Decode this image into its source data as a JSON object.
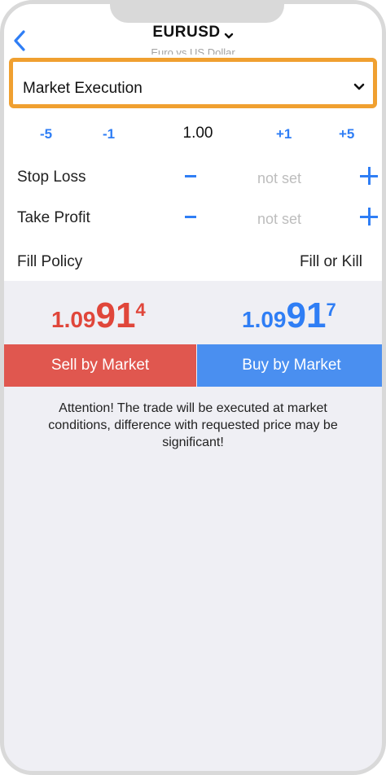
{
  "header": {
    "symbol": "EURUSD",
    "subtitle": "Euro vs US Dollar"
  },
  "execution": {
    "label": "Market Execution"
  },
  "steppers": {
    "minus5": "-5",
    "minus1": "-1",
    "volume": "1.00",
    "plus1": "+1",
    "plus5": "+5"
  },
  "stop_loss": {
    "label": "Stop Loss",
    "value": "not set"
  },
  "take_profit": {
    "label": "Take Profit",
    "value": "not set"
  },
  "fill_policy": {
    "label": "Fill Policy",
    "value": "Fill or Kill"
  },
  "prices": {
    "bid": {
      "small": "1.09",
      "big": "91",
      "sup": "4"
    },
    "ask": {
      "small": "1.09",
      "big": "91",
      "sup": "7"
    }
  },
  "buttons": {
    "sell": "Sell by Market",
    "buy": "Buy by Market"
  },
  "attention": "Attention! The trade will be executed at market conditions, difference with requested price may be significant!",
  "colors": {
    "accent_blue": "#2f7ef5",
    "sell_red": "#e0574f",
    "buy_blue": "#4a8ff0",
    "highlight_orange": "#f0a030"
  }
}
